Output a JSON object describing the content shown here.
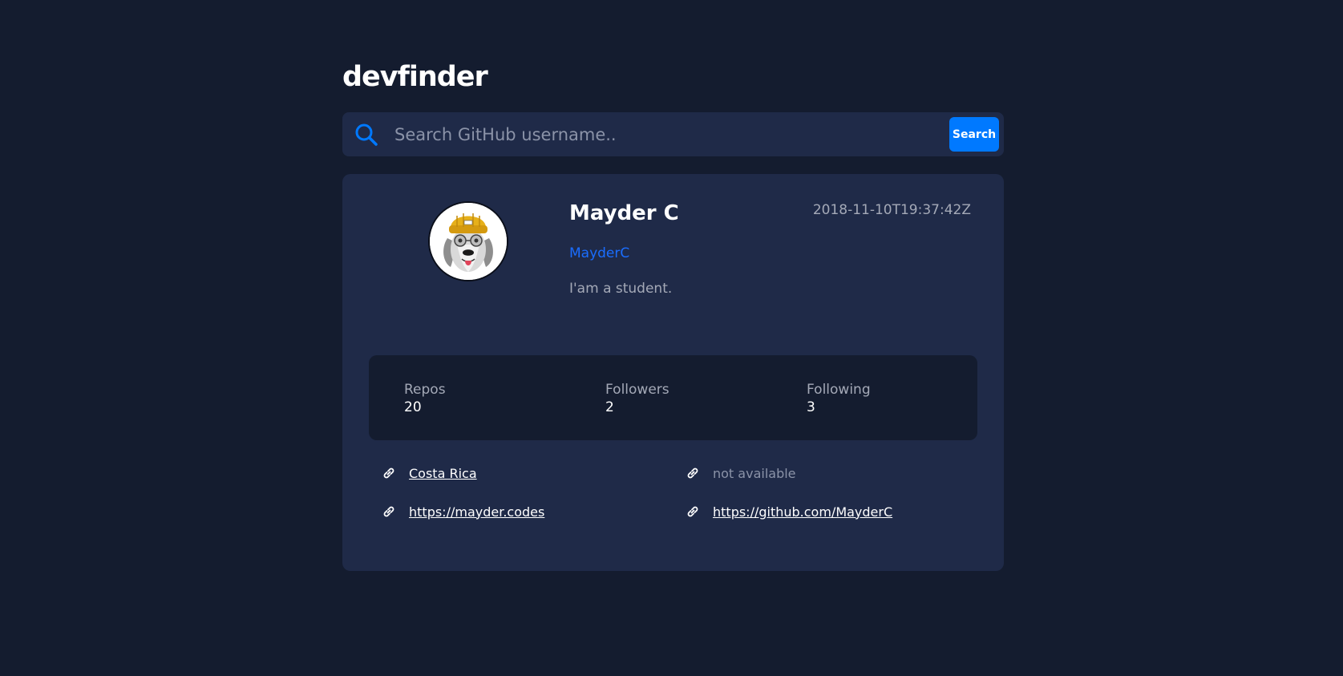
{
  "header": {
    "title": "devfinder"
  },
  "search": {
    "placeholder": "Search GitHub username..",
    "value": "",
    "button_label": "Search",
    "icon": "search-icon"
  },
  "profile": {
    "name": "Mayder C",
    "login": "MayderC",
    "created_at": "2018-11-10T19:37:42Z",
    "bio": "I'am a student.",
    "avatar": "dog-with-beanie-avatar"
  },
  "stats": [
    {
      "label": "Repos",
      "value": "20"
    },
    {
      "label": "Followers",
      "value": "2"
    },
    {
      "label": "Following",
      "value": "3"
    }
  ],
  "links": [
    {
      "text": "Costa Rica",
      "icon": "link-icon",
      "available": true
    },
    {
      "text": "not available",
      "icon": "link-icon",
      "available": false
    },
    {
      "text": "https://mayder.codes",
      "icon": "link-icon",
      "available": true
    },
    {
      "text": "https://github.com/MayderC",
      "icon": "link-icon",
      "available": true
    }
  ],
  "colors": {
    "background": "#141c2f",
    "card": "#1f2a48",
    "accent": "#0079ff",
    "login": "#1a6dff",
    "muted_text": "#a4a9b7"
  }
}
